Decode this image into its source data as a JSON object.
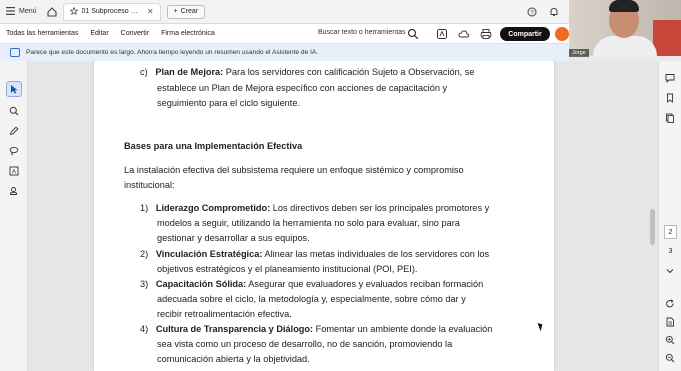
{
  "titlebar": {
    "menu_label": "Menú",
    "tab_title": "01 Subproceso GD...",
    "new_tab_label": "Crear"
  },
  "toolbar": {
    "items": [
      "Todas las herramientas",
      "Editar",
      "Convertir",
      "Firma electrónica"
    ],
    "search_label": "Buscar texto o herramientas",
    "share_label": "Compartir"
  },
  "banner": {
    "text": "Parece que este documento es largo. Ahorra tiempo leyendo un resumen usando el Asistente de IA."
  },
  "webcam": {
    "name_label": "Jorge"
  },
  "document": {
    "item_c_marker": "c)",
    "item_c_bold": "Plan de Mejora:",
    "item_c_lines": [
      " Para los servidores con calificación Sujeto a Observación, se",
      "establece un Plan de Mejora específico con acciones de capacitación y",
      "seguimiento para el ciclo siguiente."
    ],
    "heading": "Bases para una Implementación Efectiva",
    "intro_lines": [
      "La instalación efectiva del subsistema requiere un enfoque sistémico y compromiso",
      "institucional:"
    ],
    "items": [
      {
        "number": "1)",
        "bold": "Liderazgo Comprometido:",
        "lines": [
          " Los directivos deben ser los principales promotores y",
          "modelos a seguir, utilizando la herramienta no solo para evaluar, sino para",
          "gestionar y desarrollar a sus equipos."
        ]
      },
      {
        "number": "2)",
        "bold": "Vinculación Estratégica:",
        "lines": [
          " Alinear las metas individuales de los servidores con los",
          "objetivos estratégicos y el planeamiento institucional (POI, PEI)."
        ]
      },
      {
        "number": "3)",
        "bold": "Capacitación Sólida:",
        "lines": [
          " Asegurar que evaluadores y evaluados reciban formación",
          "adecuada sobre el ciclo, la metodología y, especialmente, sobre cómo dar y",
          "recibir retroalimentación efectiva."
        ]
      },
      {
        "number": "4)",
        "bold": "Cultura de Transparencia y Diálogo:",
        "lines": [
          " Fomentar un ambiente donde la evaluación",
          "sea vista como un proceso de desarrollo, no de sanción, promoviendo la",
          "comunicación abierta y la objetividad."
        ]
      }
    ]
  },
  "pages": {
    "current": "2",
    "next": "3"
  },
  "colors": {
    "accent": "#2f6fd6",
    "share_bg": "#111111",
    "banner_bg": "#e6effa"
  }
}
